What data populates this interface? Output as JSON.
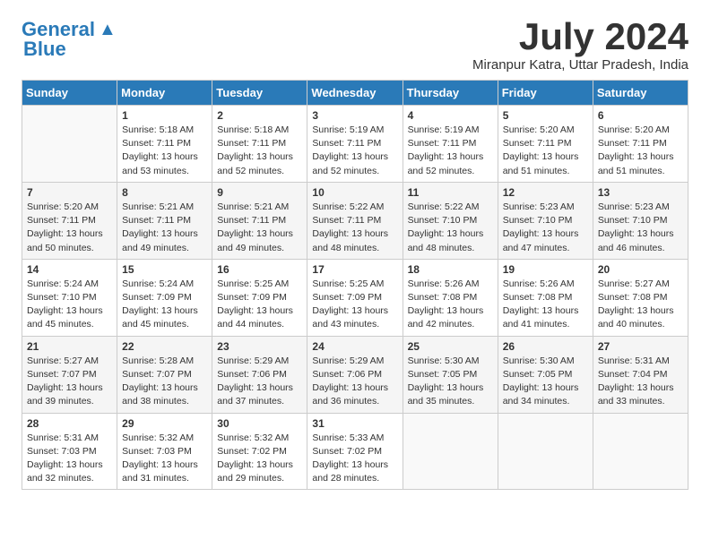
{
  "header": {
    "logo_line1": "General",
    "logo_line2": "Blue",
    "month": "July 2024",
    "location": "Miranpur Katra, Uttar Pradesh, India"
  },
  "days_of_week": [
    "Sunday",
    "Monday",
    "Tuesday",
    "Wednesday",
    "Thursday",
    "Friday",
    "Saturday"
  ],
  "weeks": [
    [
      {
        "num": "",
        "empty": true
      },
      {
        "num": "1",
        "sunrise": "Sunrise: 5:18 AM",
        "sunset": "Sunset: 7:11 PM",
        "daylight": "Daylight: 13 hours and 53 minutes."
      },
      {
        "num": "2",
        "sunrise": "Sunrise: 5:18 AM",
        "sunset": "Sunset: 7:11 PM",
        "daylight": "Daylight: 13 hours and 52 minutes."
      },
      {
        "num": "3",
        "sunrise": "Sunrise: 5:19 AM",
        "sunset": "Sunset: 7:11 PM",
        "daylight": "Daylight: 13 hours and 52 minutes."
      },
      {
        "num": "4",
        "sunrise": "Sunrise: 5:19 AM",
        "sunset": "Sunset: 7:11 PM",
        "daylight": "Daylight: 13 hours and 52 minutes."
      },
      {
        "num": "5",
        "sunrise": "Sunrise: 5:20 AM",
        "sunset": "Sunset: 7:11 PM",
        "daylight": "Daylight: 13 hours and 51 minutes."
      },
      {
        "num": "6",
        "sunrise": "Sunrise: 5:20 AM",
        "sunset": "Sunset: 7:11 PM",
        "daylight": "Daylight: 13 hours and 51 minutes."
      }
    ],
    [
      {
        "num": "7",
        "sunrise": "Sunrise: 5:20 AM",
        "sunset": "Sunset: 7:11 PM",
        "daylight": "Daylight: 13 hours and 50 minutes."
      },
      {
        "num": "8",
        "sunrise": "Sunrise: 5:21 AM",
        "sunset": "Sunset: 7:11 PM",
        "daylight": "Daylight: 13 hours and 49 minutes."
      },
      {
        "num": "9",
        "sunrise": "Sunrise: 5:21 AM",
        "sunset": "Sunset: 7:11 PM",
        "daylight": "Daylight: 13 hours and 49 minutes."
      },
      {
        "num": "10",
        "sunrise": "Sunrise: 5:22 AM",
        "sunset": "Sunset: 7:11 PM",
        "daylight": "Daylight: 13 hours and 48 minutes."
      },
      {
        "num": "11",
        "sunrise": "Sunrise: 5:22 AM",
        "sunset": "Sunset: 7:10 PM",
        "daylight": "Daylight: 13 hours and 48 minutes."
      },
      {
        "num": "12",
        "sunrise": "Sunrise: 5:23 AM",
        "sunset": "Sunset: 7:10 PM",
        "daylight": "Daylight: 13 hours and 47 minutes."
      },
      {
        "num": "13",
        "sunrise": "Sunrise: 5:23 AM",
        "sunset": "Sunset: 7:10 PM",
        "daylight": "Daylight: 13 hours and 46 minutes."
      }
    ],
    [
      {
        "num": "14",
        "sunrise": "Sunrise: 5:24 AM",
        "sunset": "Sunset: 7:10 PM",
        "daylight": "Daylight: 13 hours and 45 minutes."
      },
      {
        "num": "15",
        "sunrise": "Sunrise: 5:24 AM",
        "sunset": "Sunset: 7:09 PM",
        "daylight": "Daylight: 13 hours and 45 minutes."
      },
      {
        "num": "16",
        "sunrise": "Sunrise: 5:25 AM",
        "sunset": "Sunset: 7:09 PM",
        "daylight": "Daylight: 13 hours and 44 minutes."
      },
      {
        "num": "17",
        "sunrise": "Sunrise: 5:25 AM",
        "sunset": "Sunset: 7:09 PM",
        "daylight": "Daylight: 13 hours and 43 minutes."
      },
      {
        "num": "18",
        "sunrise": "Sunrise: 5:26 AM",
        "sunset": "Sunset: 7:08 PM",
        "daylight": "Daylight: 13 hours and 42 minutes."
      },
      {
        "num": "19",
        "sunrise": "Sunrise: 5:26 AM",
        "sunset": "Sunset: 7:08 PM",
        "daylight": "Daylight: 13 hours and 41 minutes."
      },
      {
        "num": "20",
        "sunrise": "Sunrise: 5:27 AM",
        "sunset": "Sunset: 7:08 PM",
        "daylight": "Daylight: 13 hours and 40 minutes."
      }
    ],
    [
      {
        "num": "21",
        "sunrise": "Sunrise: 5:27 AM",
        "sunset": "Sunset: 7:07 PM",
        "daylight": "Daylight: 13 hours and 39 minutes."
      },
      {
        "num": "22",
        "sunrise": "Sunrise: 5:28 AM",
        "sunset": "Sunset: 7:07 PM",
        "daylight": "Daylight: 13 hours and 38 minutes."
      },
      {
        "num": "23",
        "sunrise": "Sunrise: 5:29 AM",
        "sunset": "Sunset: 7:06 PM",
        "daylight": "Daylight: 13 hours and 37 minutes."
      },
      {
        "num": "24",
        "sunrise": "Sunrise: 5:29 AM",
        "sunset": "Sunset: 7:06 PM",
        "daylight": "Daylight: 13 hours and 36 minutes."
      },
      {
        "num": "25",
        "sunrise": "Sunrise: 5:30 AM",
        "sunset": "Sunset: 7:05 PM",
        "daylight": "Daylight: 13 hours and 35 minutes."
      },
      {
        "num": "26",
        "sunrise": "Sunrise: 5:30 AM",
        "sunset": "Sunset: 7:05 PM",
        "daylight": "Daylight: 13 hours and 34 minutes."
      },
      {
        "num": "27",
        "sunrise": "Sunrise: 5:31 AM",
        "sunset": "Sunset: 7:04 PM",
        "daylight": "Daylight: 13 hours and 33 minutes."
      }
    ],
    [
      {
        "num": "28",
        "sunrise": "Sunrise: 5:31 AM",
        "sunset": "Sunset: 7:03 PM",
        "daylight": "Daylight: 13 hours and 32 minutes."
      },
      {
        "num": "29",
        "sunrise": "Sunrise: 5:32 AM",
        "sunset": "Sunset: 7:03 PM",
        "daylight": "Daylight: 13 hours and 31 minutes."
      },
      {
        "num": "30",
        "sunrise": "Sunrise: 5:32 AM",
        "sunset": "Sunset: 7:02 PM",
        "daylight": "Daylight: 13 hours and 29 minutes."
      },
      {
        "num": "31",
        "sunrise": "Sunrise: 5:33 AM",
        "sunset": "Sunset: 7:02 PM",
        "daylight": "Daylight: 13 hours and 28 minutes."
      },
      {
        "num": "",
        "empty": true
      },
      {
        "num": "",
        "empty": true
      },
      {
        "num": "",
        "empty": true
      }
    ]
  ]
}
